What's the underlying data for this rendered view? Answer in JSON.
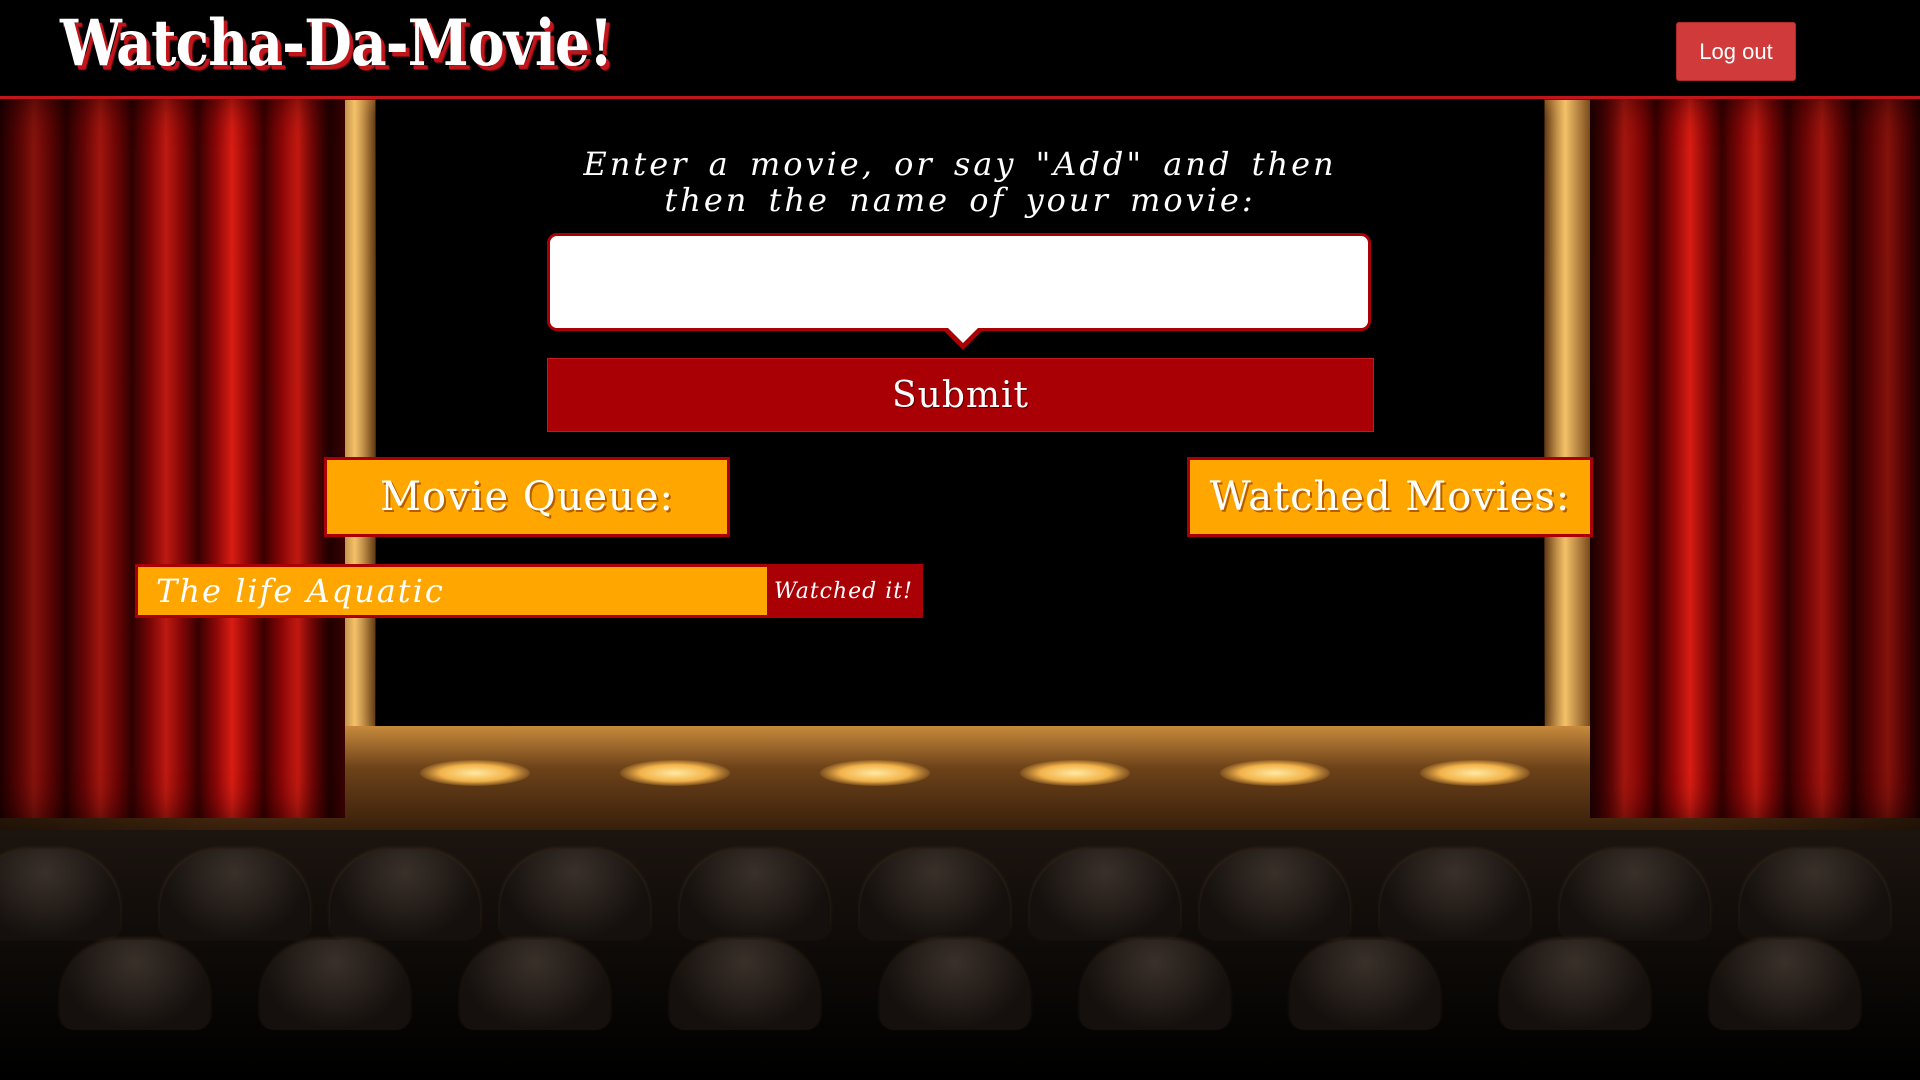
{
  "header": {
    "logo_text": "Watcha-Da-Movie!",
    "logout_label": "Log out"
  },
  "main": {
    "prompt": "Enter a movie, or say \"Add\" and then then the name of your movie:",
    "search": {
      "value": "",
      "placeholder": ""
    },
    "submit_label": "Submit"
  },
  "queue": {
    "heading": "Movie Queue:",
    "items": [
      {
        "title": "The life Aquatic",
        "action_label": "Watched it!"
      }
    ]
  },
  "watched": {
    "heading": "Watched Movies:",
    "items": []
  },
  "colors": {
    "accent_red": "#a80004",
    "accent_orange": "#ffa600",
    "logout_red": "#d13a3a"
  }
}
